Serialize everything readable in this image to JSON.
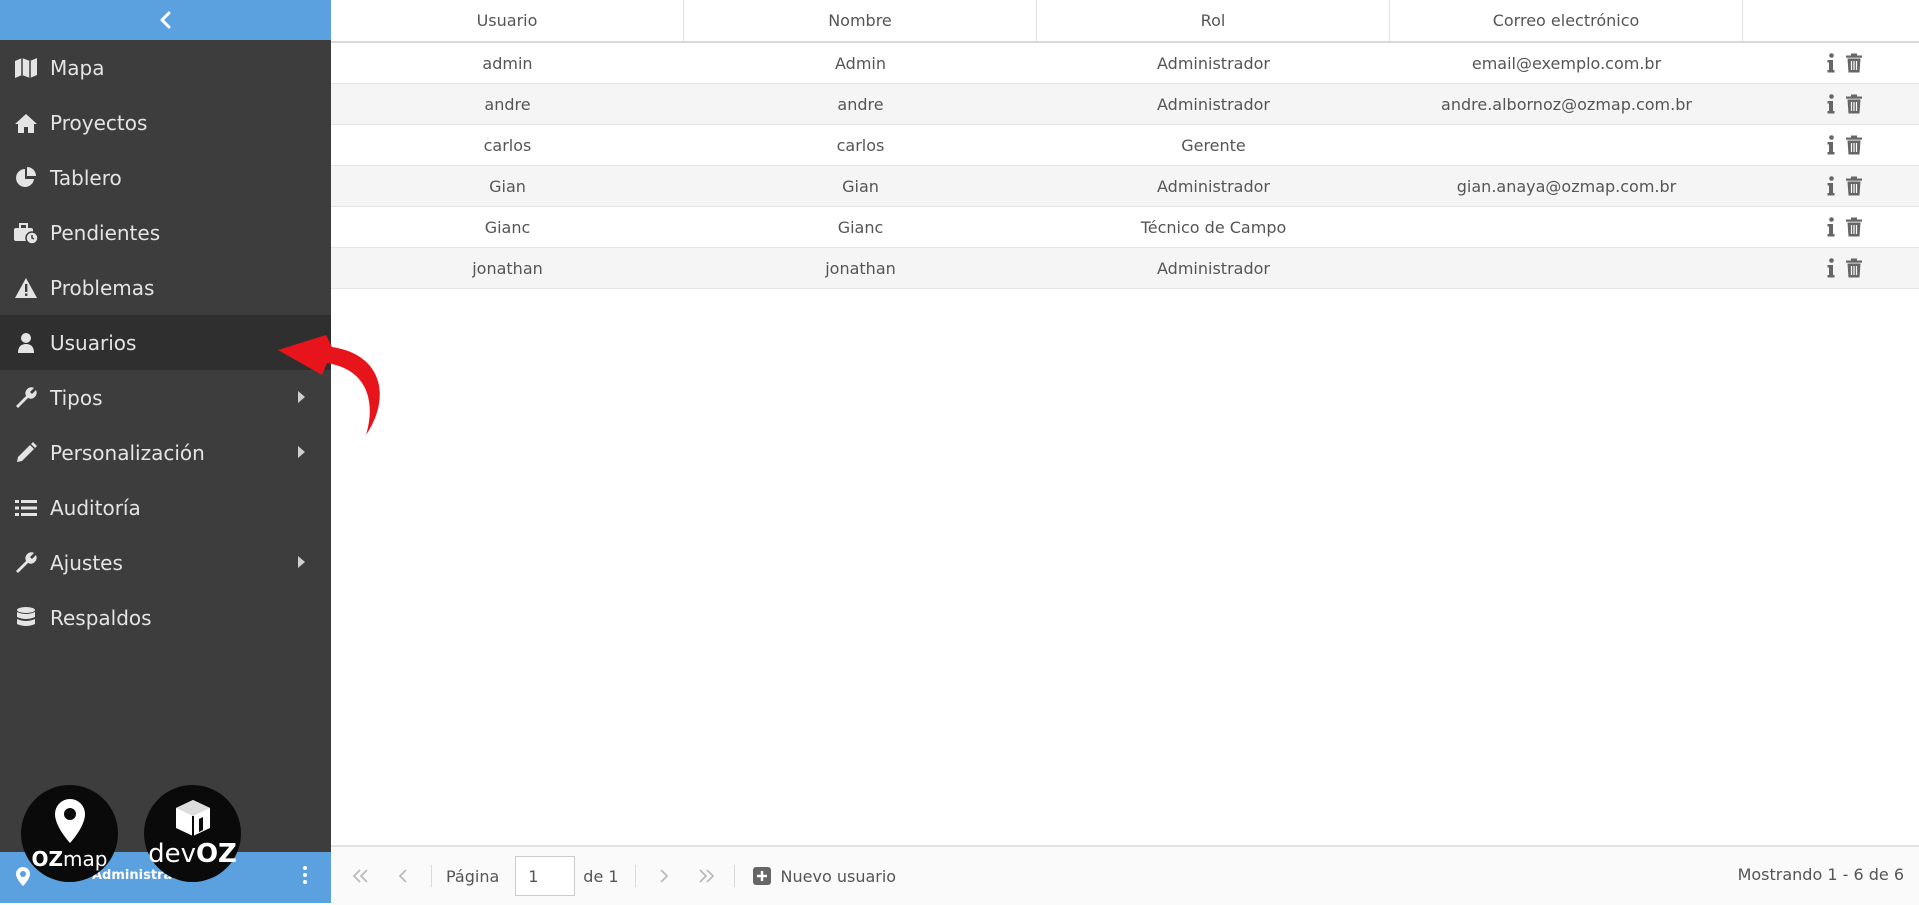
{
  "sidebar": {
    "items": [
      {
        "label": "Mapa",
        "icon": "map-icon"
      },
      {
        "label": "Proyectos",
        "icon": "home-icon"
      },
      {
        "label": "Tablero",
        "icon": "pie-chart-icon"
      },
      {
        "label": "Pendientes",
        "icon": "toolbox-clock-icon"
      },
      {
        "label": "Problemas",
        "icon": "warning-icon"
      },
      {
        "label": "Usuarios",
        "icon": "user-icon",
        "active": true
      },
      {
        "label": "Tipos",
        "icon": "wrench-icon",
        "submenu": true
      },
      {
        "label": "Personalización",
        "icon": "pencil-icon",
        "submenu": true
      },
      {
        "label": "Auditoría",
        "icon": "list-icon"
      },
      {
        "label": "Ajustes",
        "icon": "wrench-icon",
        "submenu": true
      },
      {
        "label": "Respaldos",
        "icon": "database-icon"
      }
    ],
    "footer": {
      "user_label": "Administrador"
    }
  },
  "logos": {
    "ozmap": {
      "oz": "OZ",
      "map": "map"
    },
    "devoz": {
      "dev": "dev",
      "oz": "OZ"
    }
  },
  "table": {
    "headers": [
      "Usuario",
      "Nombre",
      "Rol",
      "Correo electrónico"
    ],
    "rows": [
      {
        "usuario": "admin",
        "nombre": "Admin",
        "rol": "Administrador",
        "correo": "email@exemplo.com.br"
      },
      {
        "usuario": "andre",
        "nombre": "andre",
        "rol": "Administrador",
        "correo": "andre.albornoz@ozmap.com.br"
      },
      {
        "usuario": "carlos",
        "nombre": "carlos",
        "rol": "Gerente",
        "correo": ""
      },
      {
        "usuario": "Gian",
        "nombre": "Gian",
        "rol": "Administrador",
        "correo": "gian.anaya@ozmap.com.br"
      },
      {
        "usuario": "Gianc",
        "nombre": "Gianc",
        "rol": "Técnico de Campo",
        "correo": ""
      },
      {
        "usuario": "jonathan",
        "nombre": "jonathan",
        "rol": "Administrador",
        "correo": ""
      }
    ]
  },
  "pager": {
    "page_label": "Página",
    "page_value": "1",
    "of_label": "de 1",
    "new_user_label": "Nuevo usuario",
    "showing": "Mostrando 1 - 6 de 6"
  },
  "colors": {
    "sidebar_bg": "#3d3d3d",
    "accent": "#5ba1e0",
    "annotation": "#e8141b"
  }
}
